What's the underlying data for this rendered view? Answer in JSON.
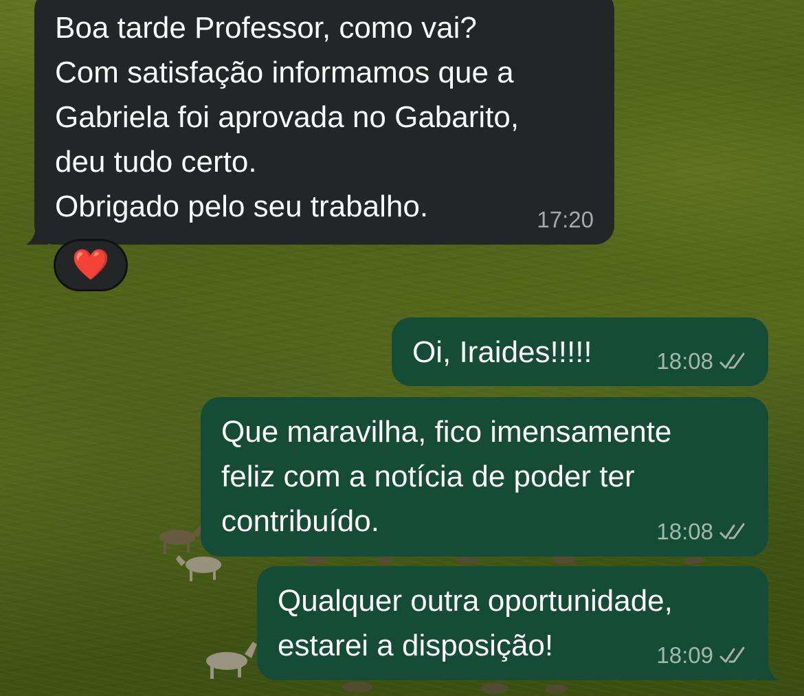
{
  "messages": [
    {
      "direction": "incoming",
      "lines": [
        "Boa tarde Professor, como vai?",
        "Com satisfação informamos que a",
        "Gabriela foi aprovada no Gabarito,",
        "deu tudo certo.",
        "Obrigado pelo seu trabalho."
      ],
      "time": "17:20",
      "reaction": "❤️"
    },
    {
      "direction": "outgoing",
      "lines": [
        "Oi, Iraides!!!!!"
      ],
      "time": "18:08",
      "status": "read-double-check"
    },
    {
      "direction": "outgoing",
      "lines": [
        "Que maravilha, fico imensamente",
        "feliz com a notícia de poder ter",
        "contribuído."
      ],
      "time": "18:08",
      "status": "read-double-check"
    },
    {
      "direction": "outgoing",
      "lines": [
        "Qualquer outra oportunidade,",
        "estarei a disposição!"
      ],
      "time": "18:09",
      "status": "read-double-check"
    }
  ],
  "colors": {
    "incoming_bubble": "#232626",
    "outgoing_bubble": "#144c38",
    "text": "#ffffff",
    "meta_text": "#a8b0ac",
    "wallpaper": "#4e6118"
  },
  "wallpaper": "green-field-with-horses"
}
